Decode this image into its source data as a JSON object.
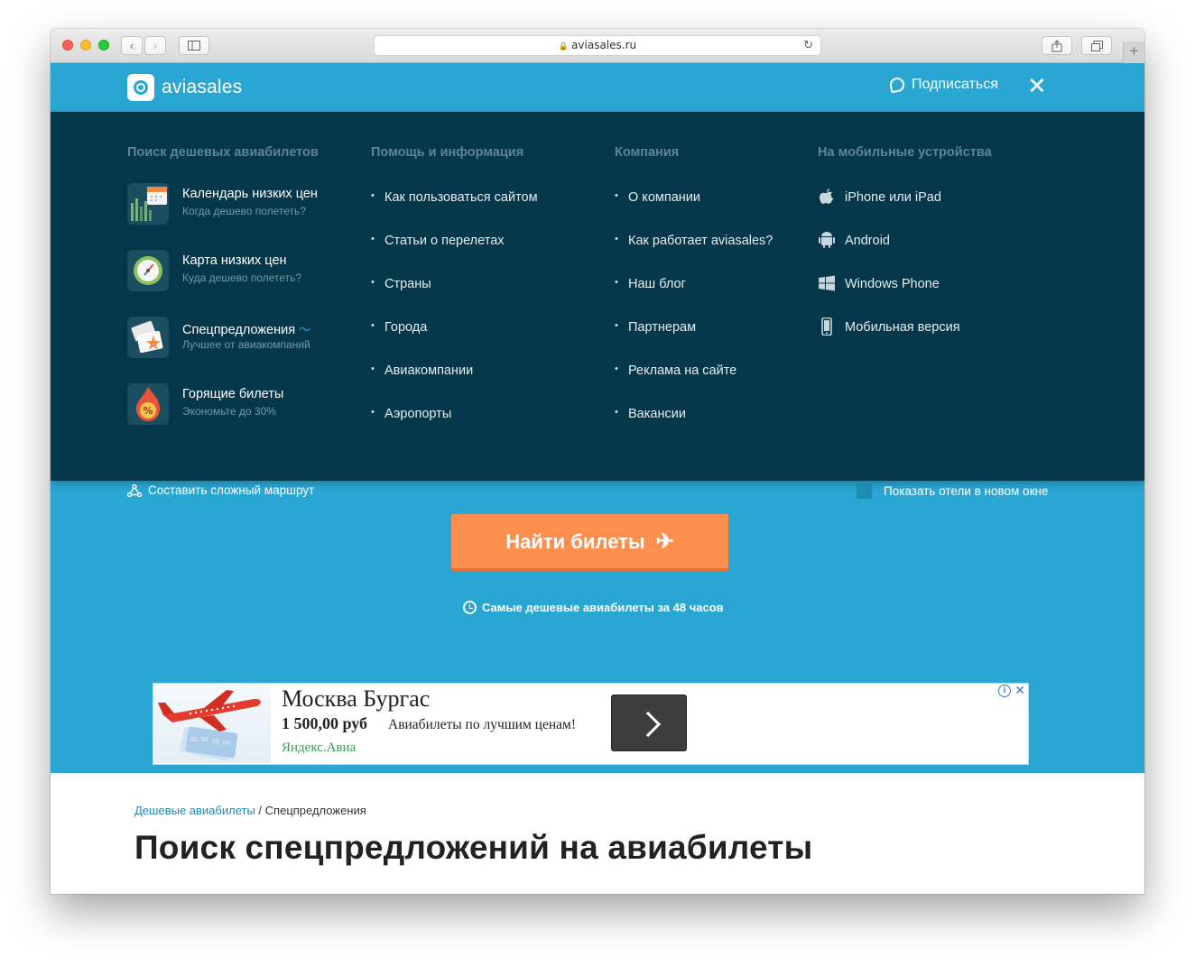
{
  "browser": {
    "url": "aviasales.ru",
    "back_icon": "chevron-left-icon",
    "forward_icon": "chevron-right-icon",
    "sidebar_icon": "sidebar-icon",
    "share_icon": "share-icon",
    "tabs_icon": "tabs-icon",
    "new_tab_icon": "plus-icon"
  },
  "header": {
    "logo_text": "aviasales",
    "subscribe_label": "Подписаться",
    "close_label": "✕"
  },
  "menu": {
    "col1_title": "Поиск дешевых авиабилетов",
    "col2_title": "Помощь и информация",
    "col3_title": "Компания",
    "col4_title": "На мобильные устройства",
    "features": [
      {
        "title": "Календарь низких цен",
        "subtitle": "Когда дешево полететь?",
        "icon": "calendar-icon"
      },
      {
        "title": "Карта низких цен",
        "subtitle": "Куда дешево полететь?",
        "icon": "compass-icon"
      },
      {
        "title": "Спецпредложения",
        "subtitle": "Лучшее от авиакомпаний",
        "icon": "tickets-star-icon"
      },
      {
        "title": "Горящие билеты",
        "subtitle": "Экономьте до 30%",
        "icon": "fire-percent-icon"
      }
    ],
    "help_links": [
      "Как пользоваться сайтом",
      "Статьи о перелетах",
      "Страны",
      "Города",
      "Авиакомпании",
      "Аэропорты"
    ],
    "company_links": [
      "О компании",
      "Как работает aviasales?",
      "Наш блог",
      "Партнерам",
      "Реклама на сайте",
      "Вакансии"
    ],
    "mobile_links": [
      {
        "label": "iPhone или iPad",
        "icon": "apple-icon"
      },
      {
        "label": "Android",
        "icon": "android-icon"
      },
      {
        "label": "Windows Phone",
        "icon": "windows-icon"
      },
      {
        "label": "Мобильная версия",
        "icon": "phone-icon"
      }
    ]
  },
  "search": {
    "complex_route_label": "Составить сложный маршрут",
    "hotels_label": "Показать отели в новом окне",
    "find_button": "Найти билеты",
    "cheapest_note": "Самые дешевые авиабилеты за 48 часов"
  },
  "ad": {
    "title": "Москва Бургас",
    "price": "1 500,00 руб",
    "description": "Авиабилеты по лучшим ценам!",
    "source": "Яндекс.Авиа"
  },
  "content": {
    "breadcrumb_link": "Дешевые авиабилеты",
    "breadcrumb_sep": " / ",
    "breadcrumb_current": "Спецпредложения",
    "heading": "Поиск спецпредложений на авиабилеты"
  },
  "colors": {
    "brand_blue": "#29a6d2",
    "menu_bg": "#05374a",
    "accent_orange": "#fd8f4e"
  }
}
